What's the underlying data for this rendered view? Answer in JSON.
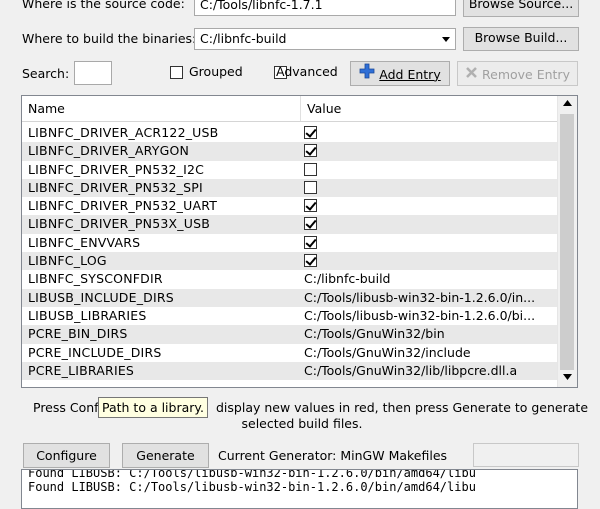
{
  "source": {
    "label": "Where is the source code:",
    "value": "C:/Tools/libnfc-1.7.1",
    "browse_label": "Browse Source..."
  },
  "build": {
    "label": "Where to build the binaries:",
    "value": "C:/libnfc-build",
    "browse_label": "Browse Build..."
  },
  "search": {
    "label": "Search:",
    "value": ""
  },
  "options": {
    "grouped_label": "Grouped",
    "grouped_checked": false,
    "advanced_label": "Advanced",
    "advanced_checked": false,
    "add_entry_label": "Add Entry",
    "remove_entry_label": "Remove Entry"
  },
  "table": {
    "columns": [
      "Name",
      "Value"
    ],
    "rows": [
      {
        "name": "LIBNFC_DRIVER_ACR122_USB",
        "type": "bool",
        "checked": true
      },
      {
        "name": "LIBNFC_DRIVER_ARYGON",
        "type": "bool",
        "checked": true
      },
      {
        "name": "LIBNFC_DRIVER_PN532_I2C",
        "type": "bool",
        "checked": false
      },
      {
        "name": "LIBNFC_DRIVER_PN532_SPI",
        "type": "bool",
        "checked": false
      },
      {
        "name": "LIBNFC_DRIVER_PN532_UART",
        "type": "bool",
        "checked": true
      },
      {
        "name": "LIBNFC_DRIVER_PN53X_USB",
        "type": "bool",
        "checked": true
      },
      {
        "name": "LIBNFC_ENVVARS",
        "type": "bool",
        "checked": true
      },
      {
        "name": "LIBNFC_LOG",
        "type": "bool",
        "checked": true
      },
      {
        "name": "LIBNFC_SYSCONFDIR",
        "type": "text",
        "value": "C:/libnfc-build"
      },
      {
        "name": "LIBUSB_INCLUDE_DIRS",
        "type": "text",
        "value": "C:/Tools/libusb-win32-bin-1.2.6.0/in..."
      },
      {
        "name": "LIBUSB_LIBRARIES",
        "type": "text",
        "value": "C:/Tools/libusb-win32-bin-1.2.6.0/bi..."
      },
      {
        "name": "PCRE_BIN_DIRS",
        "type": "text",
        "value": "C:/Tools/GnuWin32/bin"
      },
      {
        "name": "PCRE_INCLUDE_DIRS",
        "type": "text",
        "value": "C:/Tools/GnuWin32/include"
      },
      {
        "name": "PCRE_LIBRARIES",
        "type": "text",
        "value": "C:/Tools/GnuWin32/lib/libpcre.dll.a"
      }
    ]
  },
  "hint": {
    "left": "Press Confi",
    "right": "display new values in red, then press Generate to generate",
    "line2": "selected build files."
  },
  "tooltip": "Path to a library.",
  "actions": {
    "configure_label": "Configure",
    "generate_label": "Generate",
    "generator_text": "Current Generator: MinGW Makefiles"
  },
  "log": [
    "Found LIBUSB: C:/Tools/libusb-win32-bin-1.2.6.0/bin/amd64/libu",
    "Found LIBUSB: C:/Tools/libusb-win32-bin-1.2.6.0/bin/amd64/libu"
  ],
  "colors": {
    "add_icon": "#2f6fd6",
    "remove_icon": "#b0b0b0",
    "row_alt": "#e8e8e8",
    "tooltip_bg": "#ffffe1"
  }
}
